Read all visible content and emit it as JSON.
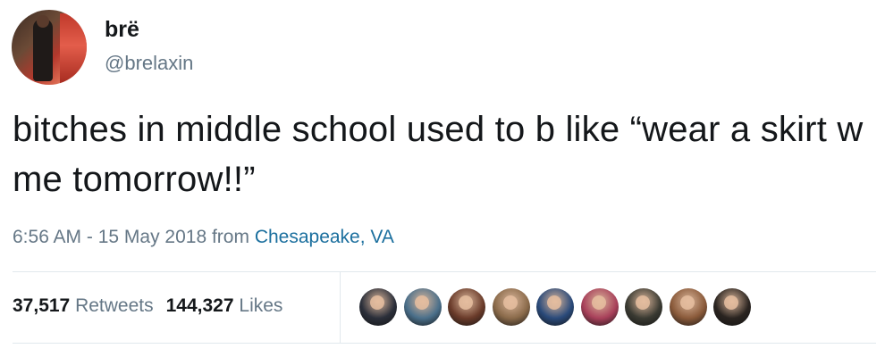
{
  "author": {
    "display_name": "brë",
    "handle": "@brelaxin",
    "avatar_icon": "profile-photo-avatar"
  },
  "tweet": {
    "text": "bitches in middle school used to b like “wear a skirt w me tomorrow!!”",
    "timestamp": "6:56 AM - 15 May 2018 from",
    "location": "Chesapeake, VA"
  },
  "stats": {
    "retweets_count": "37,517",
    "retweets_label": "Retweets",
    "likes_count": "144,327",
    "likes_label": "Likes"
  },
  "likers": [
    {
      "icon": "liker-avatar-1",
      "color": "#2b2f3a"
    },
    {
      "icon": "liker-avatar-2",
      "color": "#4a6f8a"
    },
    {
      "icon": "liker-avatar-3",
      "color": "#6a3b2a"
    },
    {
      "icon": "liker-avatar-4",
      "color": "#8a6a4a"
    },
    {
      "icon": "liker-avatar-5",
      "color": "#2a4a7a"
    },
    {
      "icon": "liker-avatar-6",
      "color": "#a8405a"
    },
    {
      "icon": "liker-avatar-7",
      "color": "#3a3a32"
    },
    {
      "icon": "liker-avatar-8",
      "color": "#8a5a3a"
    },
    {
      "icon": "liker-avatar-9",
      "color": "#2a2420"
    }
  ],
  "colors": {
    "text_primary": "#14171a",
    "text_secondary": "#657786",
    "link": "#1b6f9e",
    "divider": "#e1e8ed"
  }
}
